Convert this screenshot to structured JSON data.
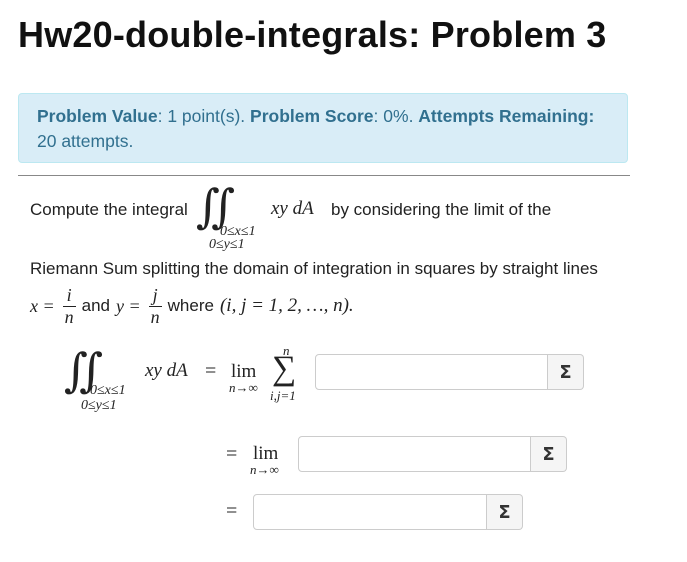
{
  "page": {
    "title": "Hw20-double-integrals: Problem 3"
  },
  "info": {
    "value_label": "Problem Value",
    "value_text": ": 1 point(s). ",
    "score_label": "Problem Score",
    "score_text": ": 0%. ",
    "attempts_label": "Attempts Remaining:",
    "attempts_text": " 20 attempts."
  },
  "problem": {
    "intro": "Compute the integral",
    "by_text": "by considering the limit of the",
    "riemann_text": "Riemann Sum splitting the domain of integration in squares by straight lines",
    "and_text": "and",
    "where_text": "where",
    "integral_sign": "∬",
    "bound_x": "0≤x≤1",
    "bound_y": "0≤y≤1",
    "integrand": "xy dA",
    "eq_x": "x =",
    "frac_x_num": "i",
    "frac_x_den": "n",
    "eq_y": "y =",
    "frac_y_num": "j",
    "frac_y_den": "n",
    "index_range": "(i, j = 1, 2, …, n).",
    "equals": "=",
    "lim": "lim",
    "lim_sub": "n→∞",
    "sum_sign": "∑",
    "sum_top": "n",
    "sum_bottom": "i,j=1"
  },
  "answers": [
    {
      "value": "",
      "button": "Σ"
    },
    {
      "value": "",
      "button": "Σ"
    },
    {
      "value": "",
      "button": "Σ"
    }
  ]
}
